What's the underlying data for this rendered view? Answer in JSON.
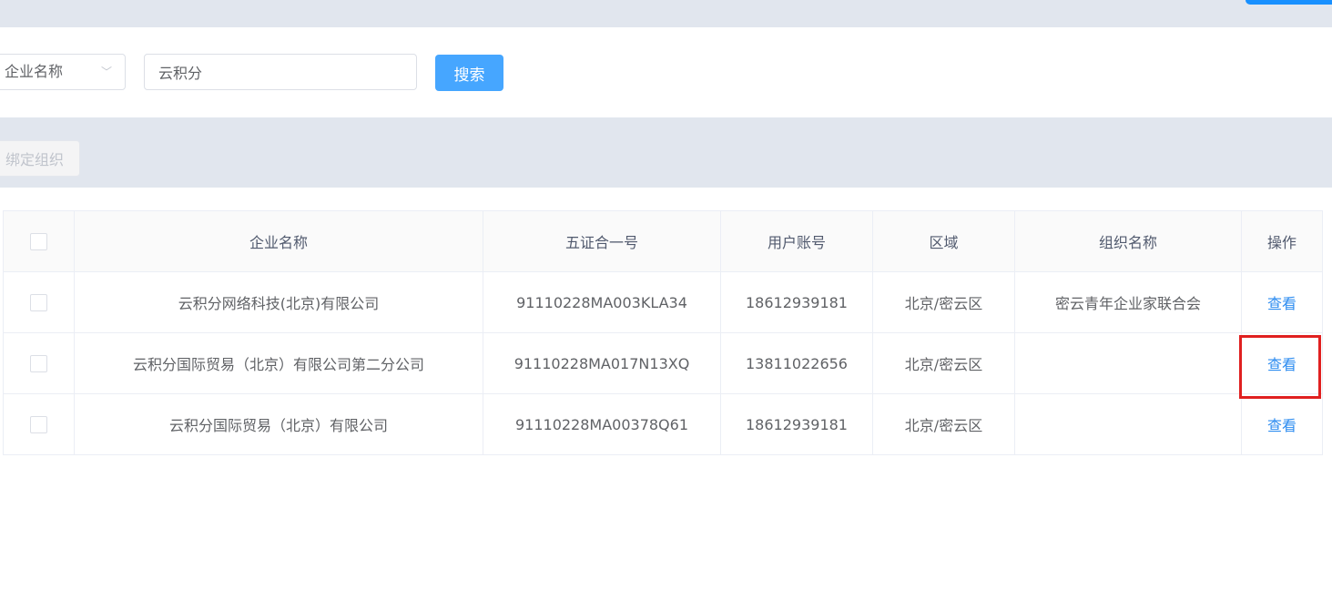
{
  "search": {
    "field_select": "企业名称",
    "keyword": "云积分",
    "search_label": "搜索"
  },
  "toolbar": {
    "bind_org_label": "绑定组织"
  },
  "table": {
    "headers": [
      "企业名称",
      "五证合一号",
      "用户账号",
      "区域",
      "组织名称",
      "操作"
    ],
    "rows": [
      {
        "name": "云积分网络科技(北京)有限公司",
        "code": "91110228MA003KLA34",
        "account": "18612939181",
        "region": "北京/密云区",
        "org": "密云青年企业家联合会",
        "action": "查看"
      },
      {
        "name": "云积分国际贸易（北京）有限公司第二分公司",
        "code": "91110228MA017N13XQ",
        "account": "13811022656",
        "region": "北京/密云区",
        "org": "",
        "action": "查看"
      },
      {
        "name": "云积分国际贸易（北京）有限公司",
        "code": "91110228MA00378Q61",
        "account": "18612939181",
        "region": "北京/密云区",
        "org": "",
        "action": "查看"
      }
    ]
  }
}
